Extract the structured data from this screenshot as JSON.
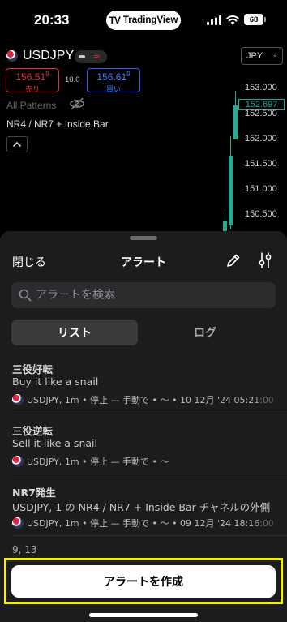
{
  "status_bar": {
    "time": "20:33",
    "app_pill": "TradingView",
    "app_logo": "TV",
    "battery": "68"
  },
  "chart": {
    "symbol": "USDJPY",
    "currency": "JPY",
    "sell": {
      "price": "156.51",
      "sup": "9",
      "label": "売り"
    },
    "buy": {
      "price": "156.61",
      "sup": "9",
      "label": "買い"
    },
    "spread": "10.0",
    "all_patterns": "All Patterns",
    "indicator": "NR4 / NR7 + Inside Bar",
    "axis_prices": [
      "153.000",
      "152.500",
      "152.000",
      "151.500",
      "151.000",
      "150.500"
    ],
    "current_price": "152.697",
    "colors": {
      "up": "#22ab94",
      "sell": "#e0323a",
      "buy": "#2962ff"
    }
  },
  "sheet": {
    "close": "閉じる",
    "title": "アラート",
    "search_placeholder": "アラートを検索",
    "tabs": {
      "list": "リスト",
      "log": "ログ"
    },
    "alerts": [
      {
        "title": "三役好転",
        "message": "Buy it like a snail",
        "meta": "USDJPY, 1m • 停止 — 手動で • 〜 • 10 12月 '24  05:21:00"
      },
      {
        "title": "三役逆転",
        "message": "Sell it like a snail",
        "meta": "USDJPY, 1m • 停止 — 手動で • 〜"
      },
      {
        "title": "NR7発生",
        "message": "USDJPY, 1 の NR4 / NR7 + Inside Bar チャネルの外側",
        "meta": "USDJPY, 1m • 停止 — 手動で • 〜 • 09 12月 '24  18:16:00"
      }
    ],
    "partial_item": "9, 13",
    "create_button": "アラートを作成"
  }
}
